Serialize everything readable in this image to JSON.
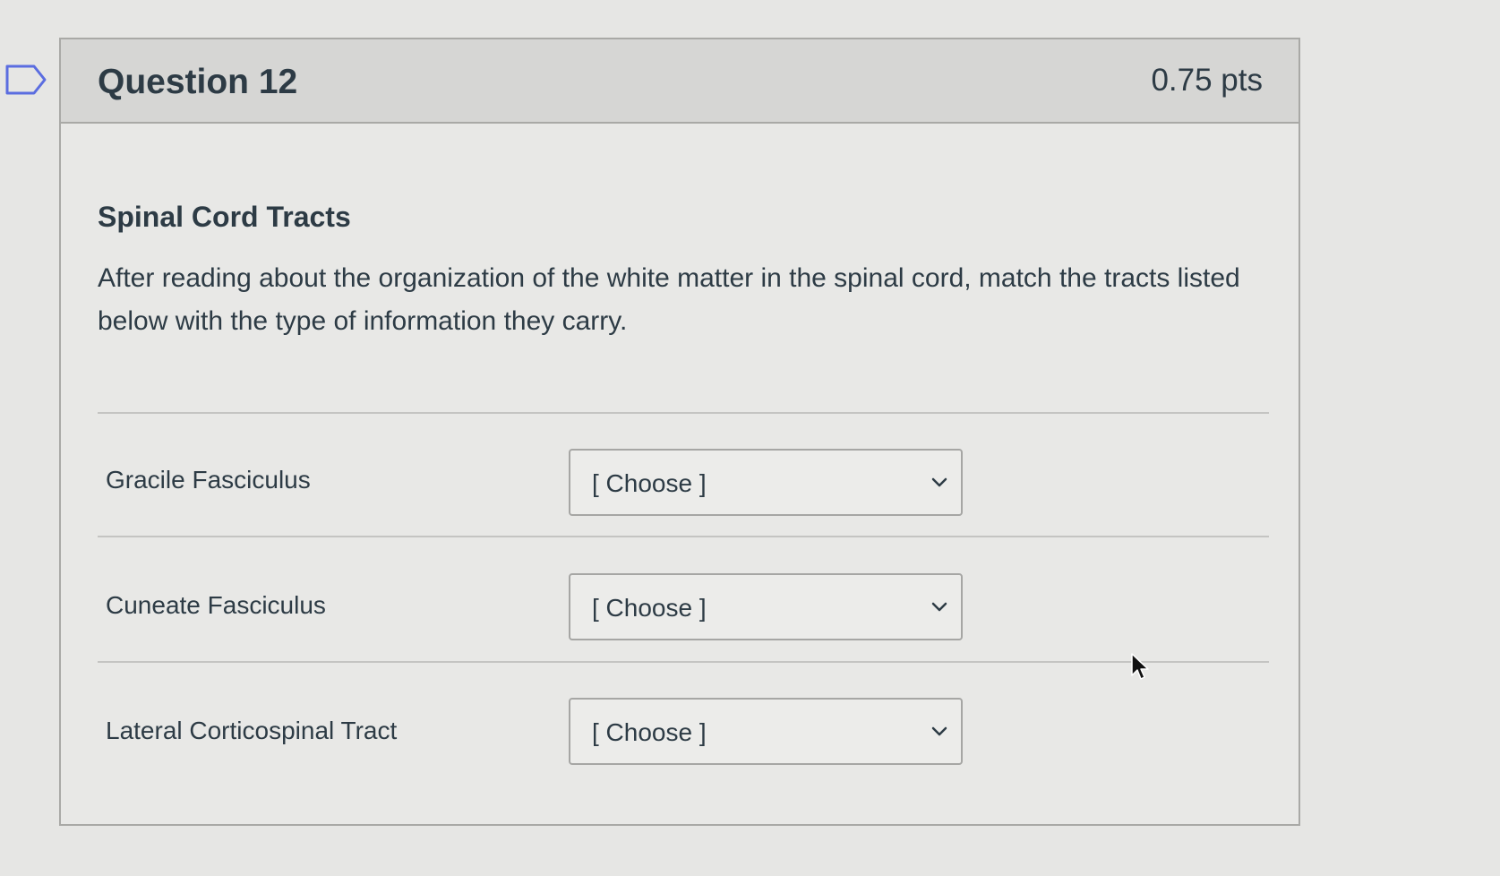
{
  "question": {
    "title": "Question 12",
    "points": "0.75 pts",
    "section_title": "Spinal Cord Tracts",
    "prompt": "After reading about the organization of the white matter in the spinal cord, match the tracts listed below with the type of information they carry."
  },
  "matches": [
    {
      "label": "Gracile Fasciculus",
      "selected": "[ Choose ]"
    },
    {
      "label": "Cuneate Fasciculus",
      "selected": "[ Choose ]"
    },
    {
      "label": "Lateral Corticospinal Tract",
      "selected": "[ Choose ]"
    }
  ],
  "icons": {
    "bookmark": "bookmark-icon",
    "dropdown": "chevron-down-icon",
    "cursor": "mouse-cursor-icon"
  },
  "colors": {
    "text": "#2d3b45",
    "header_bg": "#d6d6d4",
    "border": "#a9a9a6",
    "bookmark": "#5b6de0"
  }
}
